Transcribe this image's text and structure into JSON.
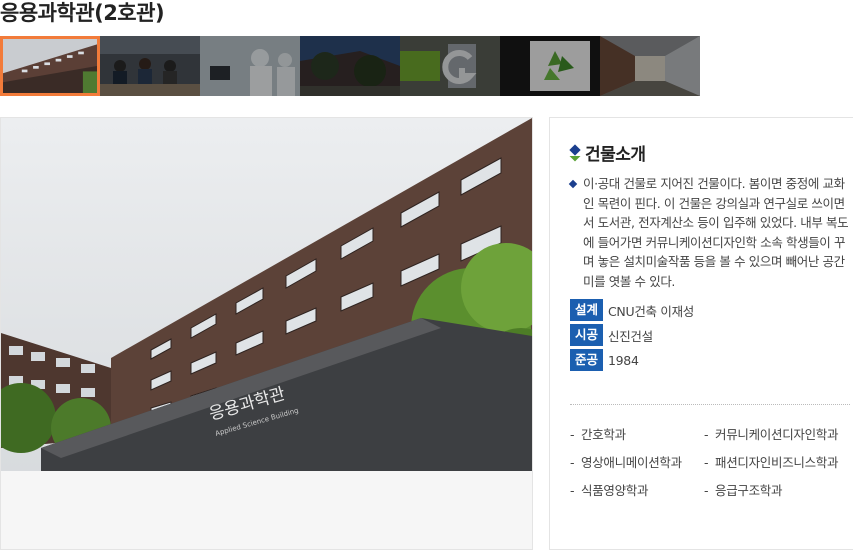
{
  "page": {
    "title": "응용과학관(2호관)"
  },
  "gallery": {
    "thumbnails": [
      {
        "name": "thumb-building-exterior",
        "active": true
      },
      {
        "name": "thumb-classroom",
        "active": false
      },
      {
        "name": "thumb-lab",
        "active": false
      },
      {
        "name": "thumb-courtyard",
        "active": false
      },
      {
        "name": "thumb-signage",
        "active": false
      },
      {
        "name": "thumb-lobby",
        "active": false
      },
      {
        "name": "thumb-corridor",
        "active": false
      }
    ],
    "main_photo_sign": "응용과학관",
    "main_photo_sign_sub": "Applied Science Building"
  },
  "info": {
    "heading": "건물소개",
    "description": "이·공대 건물로 지어진 건물이다. 봄이면 중정에 교화인 목련이 핀다. 이 건물은 강의실과 연구실로 쓰이면서 도서관, 전자계산소 등이 입주해 있었다. 내부 복도에 들어가면 커뮤니케이션디자인학 소속 학생들이 꾸며 놓은 설치미술작품 등을 볼 수 있으며 빼어난 공간미를 엿볼 수 있다.",
    "facts": [
      {
        "label": "설계",
        "value": "CNU건축 이재성"
      },
      {
        "label": "시공",
        "value": "신진건설"
      },
      {
        "label": "준공",
        "value": "1984"
      }
    ],
    "departments": [
      "간호학과",
      "커뮤니케이션디자인학과",
      "영상애니메이션학과",
      "패션디자인비즈니스학과",
      "식품영양학과",
      "응급구조학과"
    ]
  },
  "colors": {
    "accent_orange": "#f27b3a",
    "label_blue": "#1b5fb0",
    "icon_navy": "#1b3f8e",
    "icon_green": "#5aa236"
  }
}
